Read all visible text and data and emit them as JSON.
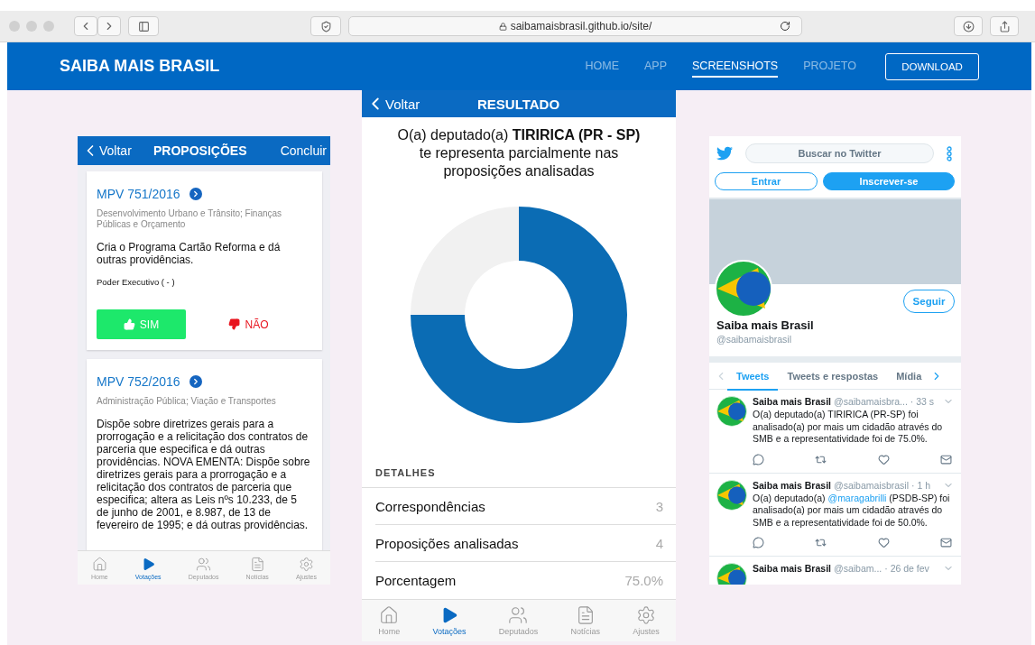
{
  "browser": {
    "url": "saibamaisbrasil.github.io/site/"
  },
  "nav": {
    "brand": "SAIBA MAIS BRASIL",
    "links": [
      {
        "label": "HOME",
        "selected": false
      },
      {
        "label": "APP",
        "selected": false
      },
      {
        "label": "SCREENSHOTS",
        "selected": true
      },
      {
        "label": "PROJETO",
        "selected": false
      }
    ],
    "button": "DOWNLOAD"
  },
  "proposicoes_screen": {
    "back": "Voltar",
    "title": "PROPOSIÇÕES",
    "action": "Concluir",
    "cards": [
      {
        "code": "MPV 751/2016",
        "topic": "Desenvolvimento Urbano e Trânsito; Finanças Públicas e Orçamento",
        "description": "Cria o Programa Cartão Reforma e dá outras providências.",
        "author": "Poder Executivo ( - )",
        "votes": [
          {
            "label": "SIM",
            "kind": "yes",
            "selected": true
          },
          {
            "label": "NÃO",
            "kind": "no",
            "selected": false
          }
        ]
      },
      {
        "code": "MPV 752/2016",
        "topic": "Administração Pública; Viação e Transportes",
        "description": "Dispõe sobre diretrizes gerais para a prorrogação e a relicitação dos contratos de parceria que especifica e dá outras providências. NOVA EMENTA: Dispõe sobre diretrizes gerais para a prorrogação e a relicitação dos contratos de parceria que especifica; altera as Leis nºs 10.233, de 5 de junho de 2001, e 8.987, de 13 de fevereiro de 1995; e dá outras providências."
      }
    ],
    "tabs": [
      {
        "label": "Home",
        "kind": "home",
        "selected": false
      },
      {
        "label": "Votações",
        "kind": "play",
        "selected": true
      },
      {
        "label": "Deputados",
        "kind": "people",
        "selected": false
      },
      {
        "label": "Notícias",
        "kind": "document",
        "selected": false
      },
      {
        "label": "Ajustes",
        "kind": "gear",
        "selected": false
      }
    ]
  },
  "resultado_screen": {
    "back": "Voltar",
    "title": "RESULTADO",
    "message": "O(a) deputado(a) **TIRIRICA (PR - SP)** te representa parcialmente nas proposições analisadas",
    "section": "DETALHES",
    "details": [
      {
        "label": "Correspondências",
        "value": "3"
      },
      {
        "label": "Proposições analisadas",
        "value": "4"
      },
      {
        "label": "Porcentagem",
        "value": "75.0%"
      }
    ],
    "tabs": [
      {
        "label": "Home",
        "kind": "home",
        "selected": false
      },
      {
        "label": "Votações",
        "kind": "play",
        "selected": true
      },
      {
        "label": "Deputados",
        "kind": "people",
        "selected": false
      },
      {
        "label": "Notícias",
        "kind": "document",
        "selected": false
      },
      {
        "label": "Ajustes",
        "kind": "gear",
        "selected": false
      }
    ]
  },
  "twitter_screen": {
    "search": {
      "placeholder": "Buscar no Twitter"
    },
    "login": "Entrar",
    "signup": "Inscrever-se",
    "follow": "Seguir",
    "name": "Saiba mais Brasil",
    "handle": "@saibamaisbrasil",
    "tabs": [
      {
        "label": "Tweets",
        "selected": true
      },
      {
        "label": "Tweets e respostas",
        "selected": false
      },
      {
        "label": "Mídia",
        "selected": false
      }
    ],
    "tweets": [
      {
        "name": "Saiba mais Brasil",
        "handle": "@saibamaisbra...",
        "time": "· 33 s",
        "text": "O(a) deputado(a) TIRIRICA (PR-SP) foi analisado(a) por mais um cidadão através do SMB e a representatividade foi de 75.0%."
      },
      {
        "name": "Saiba mais Brasil",
        "handle": "@saibamaisbrasil",
        "time": "· 1 h",
        "text_before": "O(a) deputado(a) ",
        "mention": "@maragabrilli",
        "text_after": " (PSDB-SP) foi analisado(a) por mais um cidadão através do SMB e a representatividade foi de 50.0%."
      },
      {
        "name": "Saiba mais Brasil",
        "handle": "@saibam...",
        "time": "· 26 de fev"
      }
    ]
  }
}
